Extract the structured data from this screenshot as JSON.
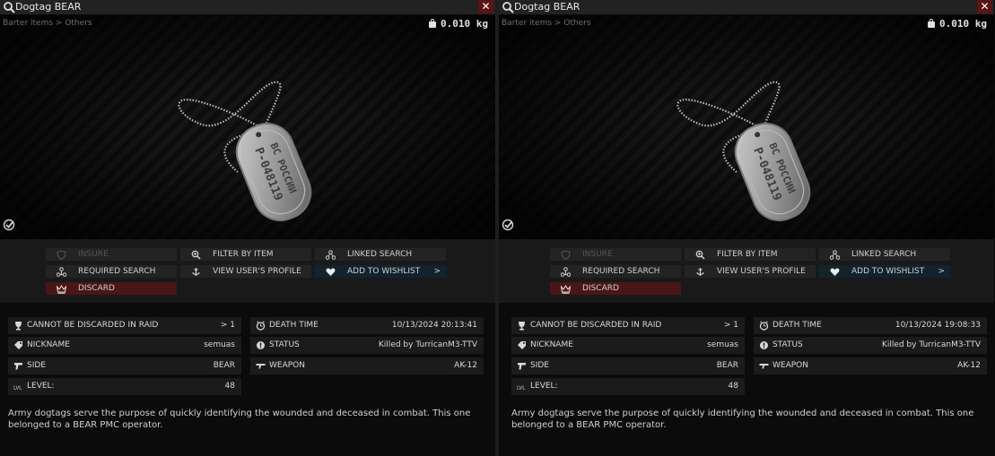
{
  "windows": [
    {
      "title": "Dogtag BEAR",
      "close_label": "✕",
      "breadcrumb": "Barter items > Others",
      "weight": "0.010 kg",
      "tag_text_line1": "ВС РОССИИ",
      "tag_text_line2": "P-048119",
      "actions": {
        "insure": "INSURE",
        "filter_by_item": "FILTER BY ITEM",
        "linked_search": "LINKED SEARCH",
        "required_search": "REQUIRED SEARCH",
        "view_profile": "VIEW USER'S PROFILE",
        "add_to_wishlist": "ADD TO WISHLIST",
        "wishlist_arrow": ">",
        "discard": "DISCARD"
      },
      "props": {
        "cannot_discard_label": "CANNOT BE DISCARDED IN RAID",
        "cannot_discard_value": "> 1",
        "nickname_label": "NICKNAME",
        "nickname_value": "semuas",
        "side_label": "SIDE",
        "side_value": "BEAR",
        "level_label": "LEVEL:",
        "level_value": "48",
        "death_time_label": "DEATH TIME",
        "death_time_value": "10/13/2024 20:13:41",
        "status_label": "STATUS",
        "status_value": "Killed by TurricanM3-TTV",
        "weapon_label": "WEAPON",
        "weapon_value": "AK-12"
      },
      "description": "Army dogtags serve the purpose of quickly identifying the wounded and deceased in combat. This one belonged to a BEAR PMC operator."
    },
    {
      "title": "Dogtag BEAR",
      "close_label": "✕",
      "breadcrumb": "Barter items > Others",
      "weight": "0.010 kg",
      "tag_text_line1": "ВС РОССИИ",
      "tag_text_line2": "P-048119",
      "actions": {
        "insure": "INSURE",
        "filter_by_item": "FILTER BY ITEM",
        "linked_search": "LINKED SEARCH",
        "required_search": "REQUIRED SEARCH",
        "view_profile": "VIEW USER'S PROFILE",
        "add_to_wishlist": "ADD TO WISHLIST",
        "wishlist_arrow": ">",
        "discard": "DISCARD"
      },
      "props": {
        "cannot_discard_label": "CANNOT BE DISCARDED IN RAID",
        "cannot_discard_value": "> 1",
        "nickname_label": "NICKNAME",
        "nickname_value": "semuas",
        "side_label": "SIDE",
        "side_value": "BEAR",
        "level_label": "LEVEL:",
        "level_value": "48",
        "death_time_label": "DEATH TIME",
        "death_time_value": "10/13/2024 19:08:33",
        "status_label": "STATUS",
        "status_value": "Killed by TurricanM3-TTV",
        "weapon_label": "WEAPON",
        "weapon_value": "AK-12"
      },
      "description": "Army dogtags serve the purpose of quickly identifying the wounded and deceased in combat. This one belonged to a BEAR PMC operator."
    }
  ],
  "colors": {
    "titlebar": "#222222",
    "close_button": "#5a1414",
    "wishlist_button": "#13232d",
    "discard_button": "#4a1616",
    "action_button": "#232323",
    "property_row": "#1b1b1b"
  },
  "icons": [
    "magnifier-icon",
    "weight-icon",
    "examined-icon",
    "shield-icon",
    "magnifier-plus-icon",
    "linked-nodes-icon",
    "required-nodes-icon",
    "profile-icon",
    "heart-icon",
    "crown-discard-icon",
    "trophy-icon",
    "tag-icon",
    "pistol-icon",
    "level-icon",
    "clock-icon",
    "status-icon",
    "rifle-icon"
  ]
}
